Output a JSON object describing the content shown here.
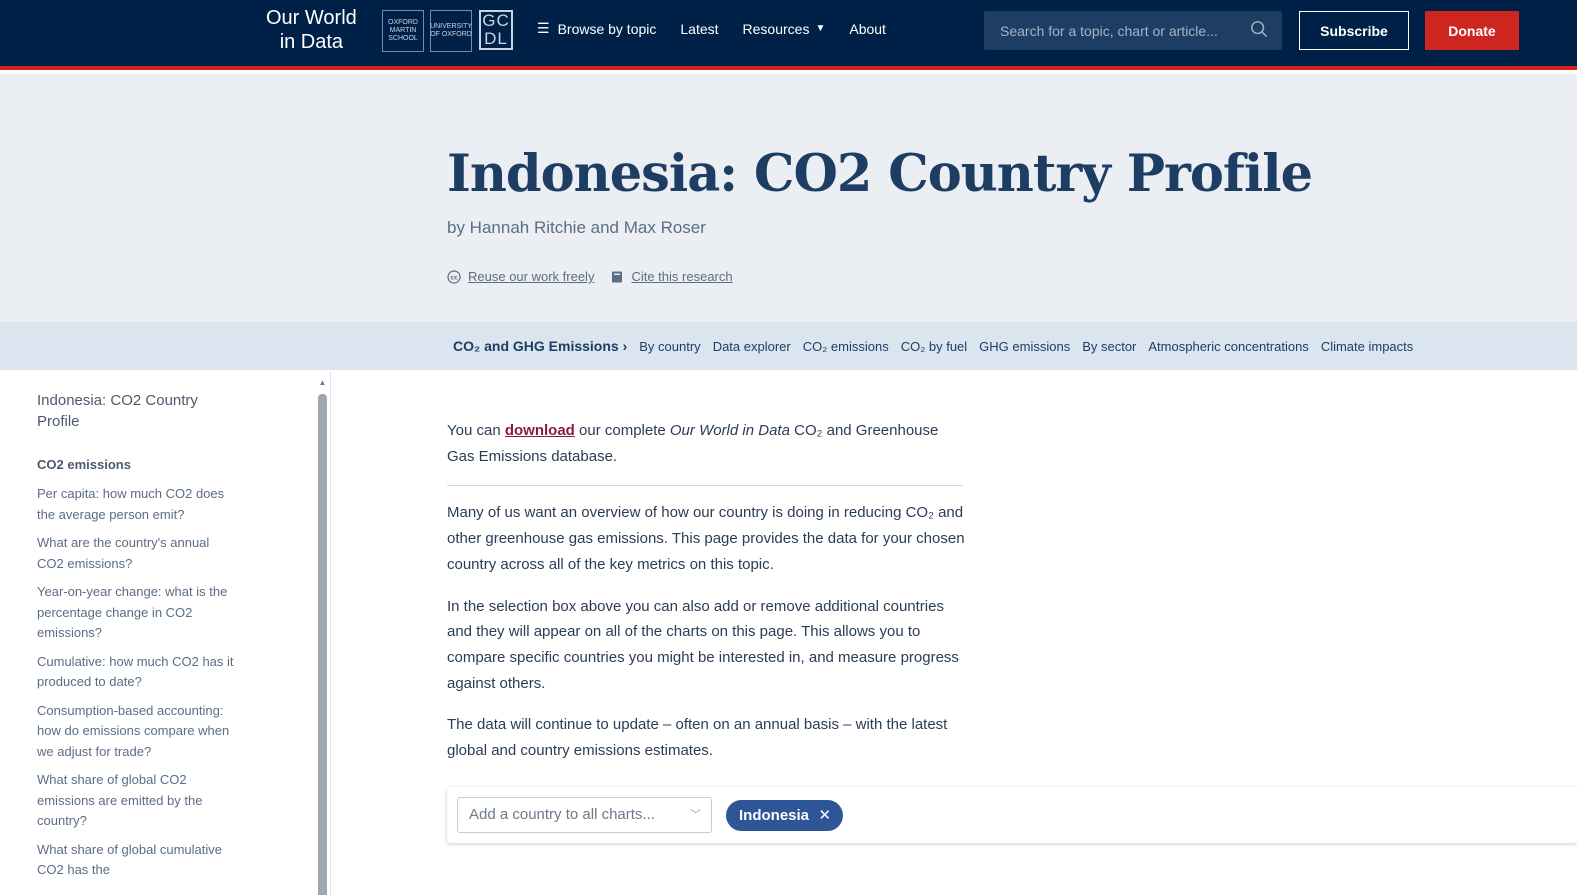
{
  "header": {
    "logo_line1": "Our World",
    "logo_line2": "in Data",
    "badges": [
      "OXFORD MARTIN SCHOOL",
      "UNIVERSITY OF OXFORD",
      "GC DL"
    ],
    "nav": [
      {
        "label": "Browse by topic",
        "icon": "list-icon"
      },
      {
        "label": "Latest"
      },
      {
        "label": "Resources",
        "icon": "caret-down-icon"
      },
      {
        "label": "About"
      }
    ],
    "search_placeholder": "Search for a topic, chart or article...",
    "subscribe_label": "Subscribe",
    "donate_label": "Donate",
    "colors": {
      "navy": "#002147",
      "red": "#ce261e"
    }
  },
  "hero": {
    "title": "Indonesia: CO2 Country Profile",
    "byline": "by Hannah Ritchie and Max Roser",
    "reuse_label": "Reuse our work freely",
    "cite_label": "Cite this research"
  },
  "subnav": {
    "root": "CO₂ and GHG Emissions",
    "items": [
      "By country",
      "Data explorer",
      "CO₂ emissions",
      "CO₂ by fuel",
      "GHG emissions",
      "By sector",
      "Atmospheric concentrations",
      "Climate impacts"
    ]
  },
  "toc": {
    "head": "Indonesia: CO2 Country Profile",
    "section": "CO2 emissions",
    "items": [
      "Per capita: how much CO2 does the average person emit?",
      "What are the country's annual CO2 emissions?",
      "Year-on-year change: what is the percentage change in CO2 emissions?",
      "Cumulative: how much CO2 has it produced to date?",
      "Consumption-based accounting: how do emissions compare when we adjust for trade?",
      "What share of global CO2 emissions are emitted by the country?",
      "What share of global cumulative CO2 has the"
    ]
  },
  "main": {
    "p1_before": "You can ",
    "p1_link": "download",
    "p1_mid": " our complete ",
    "p1_em": "Our World in Data",
    "p1_after": " CO₂ and Greenhouse Gas Emissions database.",
    "p2": "Many of us want an overview of how our country is doing in reducing CO₂ and other greenhouse gas emissions. This page provides the data for your chosen country across all of the key metrics on this topic.",
    "p3": "In the selection box above you can also add or remove additional countries and they will appear on all of the charts on this page. This allows you to compare specific countries you might be interested in, and measure progress against others.",
    "p4": "The data will continue to update – often on an annual basis – with the latest global and country emissions estimates."
  },
  "selector": {
    "placeholder": "Add a country to all charts...",
    "selected": "Indonesia"
  }
}
